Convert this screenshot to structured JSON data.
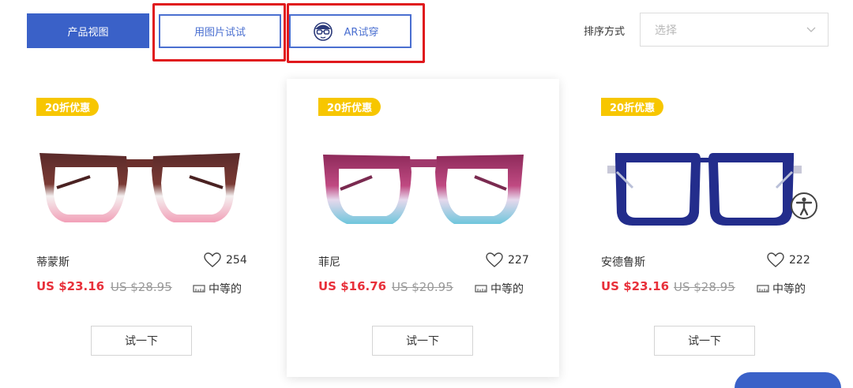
{
  "toolbar": {
    "product_view": "产品视图",
    "try_with_photo": "用图片试试",
    "ar_try_on": "AR试穿",
    "sort_label": "排序方式",
    "sort_placeholder": "选择"
  },
  "colors": {
    "accent": "#3a61c8",
    "highlight_box": "#e0191d",
    "badge": "#f7c600",
    "price": "#e8303a"
  },
  "products": [
    {
      "badge": "20折优惠",
      "name": "蒂蒙斯",
      "likes": "254",
      "price": "US $23.16",
      "old_price": "US $28.95",
      "size": "中等的",
      "try_label": "试一下"
    },
    {
      "badge": "20折优惠",
      "name": "菲尼",
      "likes": "227",
      "price": "US $16.76",
      "old_price": "US $20.95",
      "size": "中等的",
      "try_label": "试一下"
    },
    {
      "badge": "20折优惠",
      "name": "安德鲁斯",
      "likes": "222",
      "price": "US $23.16",
      "old_price": "US $28.95",
      "size": "中等的",
      "try_label": "试一下"
    }
  ]
}
